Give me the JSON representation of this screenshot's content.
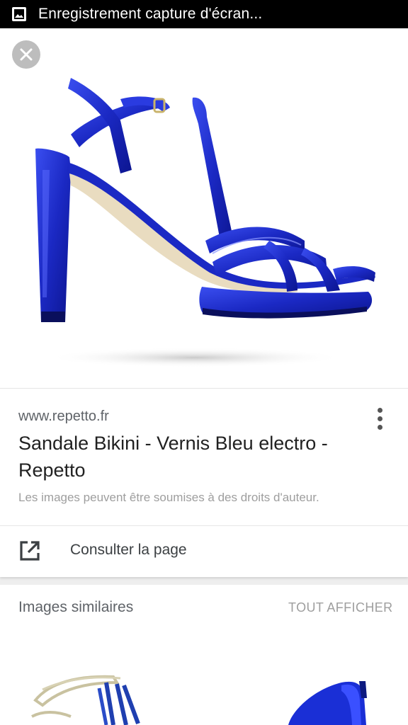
{
  "status_bar": {
    "notification_text": "Enregistrement capture d'écran...",
    "notification_icon": "image-icon"
  },
  "viewer": {
    "close_icon": "close-icon",
    "image_alt": "Sandale Bikini - Vernis Bleu electro - Repetto"
  },
  "result": {
    "source": "www.repetto.fr",
    "title": "Sandale Bikini - Vernis Bleu electro - Repetto",
    "copyright": "Les images peuvent être soumises à des droits d'auteur.",
    "more_icon": "more-vert-icon",
    "visit_label": "Consulter la page",
    "visit_icon": "open-in-new-icon"
  },
  "similar": {
    "heading": "Images similaires",
    "see_all": "TOUT AFFICHER"
  },
  "colors": {
    "shoe_blue": "#1f2fd0",
    "status_bg": "#000000",
    "text_primary": "#212121",
    "text_secondary": "#5f6368"
  }
}
